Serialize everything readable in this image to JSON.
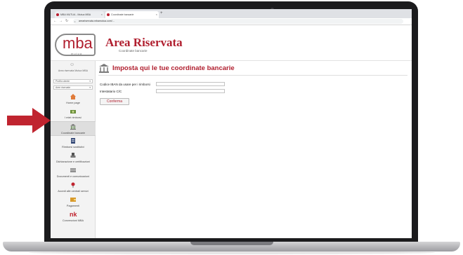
{
  "browser": {
    "tabs": [
      {
        "label": "MBA MUTUA - Mutua MBA"
      },
      {
        "label": "Coordinate bancarie"
      }
    ],
    "url": "areariservata.mbamutua.com/..."
  },
  "header": {
    "logo_text": "mba",
    "logo_sub": "mutua",
    "title": "Area Riservata",
    "subtitle": "Coordinate bancarie"
  },
  "sidebar": {
    "brand_text": "Area riservata Mutua MBA",
    "selects": [
      {
        "label": "Profilo utente"
      },
      {
        "label": "Aree riservate"
      }
    ],
    "items": [
      {
        "label": "Home page",
        "icon": "home-icon"
      },
      {
        "label": "I miei rimborsi",
        "icon": "money-icon"
      },
      {
        "label": "Coordinate bancarie",
        "icon": "bank-icon"
      },
      {
        "label": "Rimborsi sostitutivi",
        "icon": "document-icon"
      },
      {
        "label": "Dichiarazione e certificazioni",
        "icon": "stamp-icon"
      },
      {
        "label": "Documenti e comunicazioni",
        "icon": "folder-icon"
      },
      {
        "label": "Accedi alle centrali servizi",
        "icon": "network-icon"
      },
      {
        "label": "Pagamenti",
        "icon": "wallet-icon"
      },
      {
        "label": "Convenzioni MBA",
        "icon": "nk-icon",
        "glyph": "nk"
      }
    ]
  },
  "main": {
    "title": "Imposta qui le tue coordinate bancarie",
    "fields": [
      {
        "label": "Codice IBAN da usare per i rimborsi",
        "value": ""
      },
      {
        "label": "Intestatario C/C",
        "value": ""
      }
    ],
    "confirm_label": "Conferma"
  },
  "colors": {
    "brand": "#b01e2e",
    "arrow": "#c0242f",
    "sidebar_bg": "#f3f3f3"
  }
}
